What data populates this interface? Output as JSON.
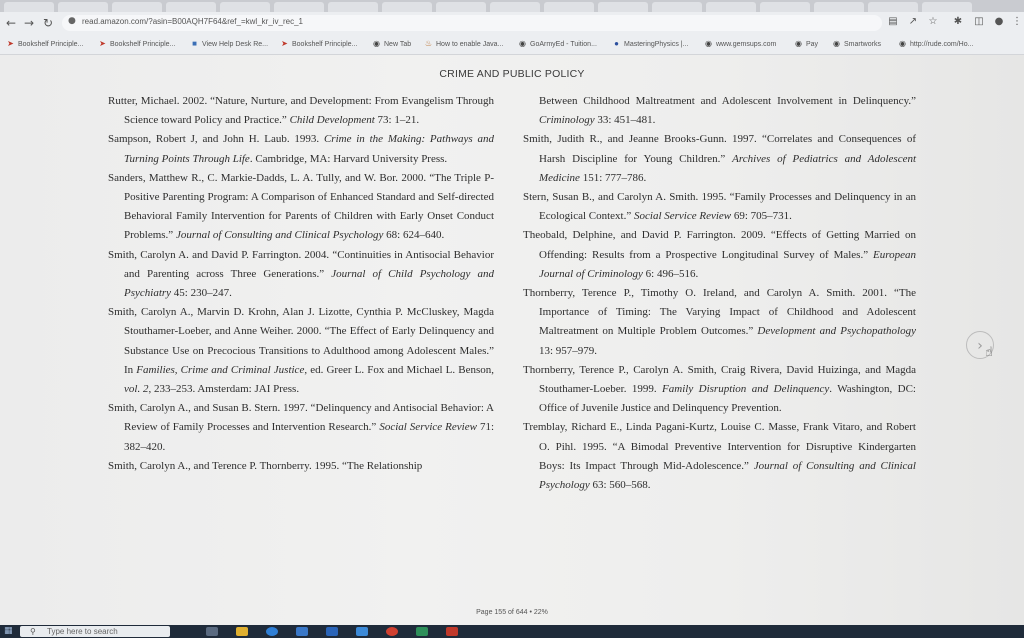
{
  "browser": {
    "url": "read.amazon.com/?asin=B00AQH7F64&ref_=kwl_kr_iv_rec_1",
    "bookmarks": [
      {
        "label": "Bookshelf Principle...",
        "icon": "bookmark-arrow-icon"
      },
      {
        "label": "Bookshelf Principle...",
        "icon": "bookmark-arrow-icon"
      },
      {
        "label": "View Help Desk Re...",
        "icon": "helpdesk-icon"
      },
      {
        "label": "Bookshelf Principle...",
        "icon": "bookmark-arrow-icon"
      },
      {
        "label": "New Tab",
        "icon": "globe-icon"
      },
      {
        "label": "How to enable Java...",
        "icon": "java-icon"
      },
      {
        "label": "GoArmyEd - Tuition...",
        "icon": "globe-icon"
      },
      {
        "label": "MasteringPhysics |...",
        "icon": "mastering-icon"
      },
      {
        "label": "www.gemsups.com",
        "icon": "globe-icon"
      },
      {
        "label": "Pay",
        "icon": "globe-icon"
      },
      {
        "label": "Smartworks",
        "icon": "globe-icon"
      },
      {
        "label": "http://rude.com/Ho...",
        "icon": "globe-icon"
      }
    ]
  },
  "document": {
    "running_head": "CRIME AND PUBLIC POLICY",
    "page_indicator": "Page 155 of 644 • 22%"
  },
  "taskbar": {
    "search_placeholder": "Type here to search"
  },
  "colors": {
    "page_bg": "#efefee",
    "text": "#2e2e2e",
    "taskbar": "#1f2b3a"
  }
}
